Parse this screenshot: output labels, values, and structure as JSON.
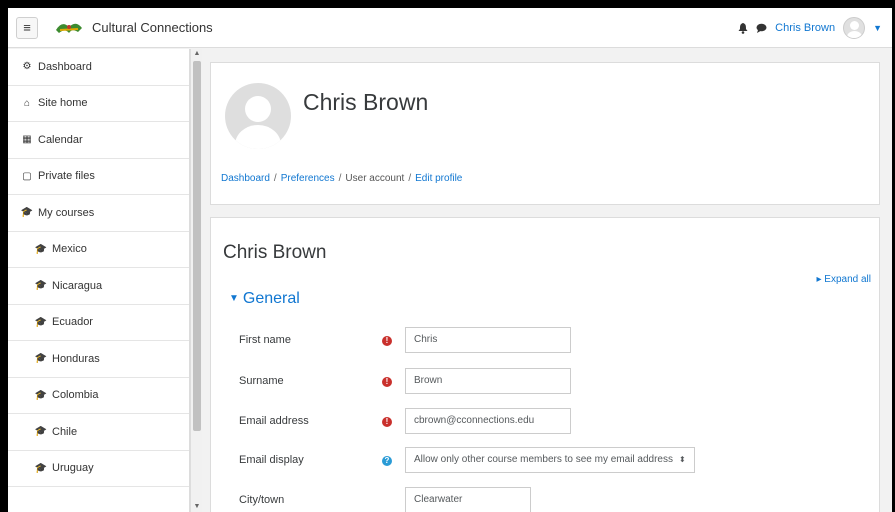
{
  "navbar": {
    "site_name": "Cultural Connections",
    "user_name": "Chris Brown",
    "menu_icon": "≡",
    "bell_icon": "🔔",
    "chat_icon": "●",
    "caret": "▼"
  },
  "sidebar": {
    "items": [
      {
        "label": "Dashboard",
        "icon": "dashboard-icon",
        "glyph": "⚙"
      },
      {
        "label": "Site home",
        "icon": "home-icon",
        "glyph": "⌂"
      },
      {
        "label": "Calendar",
        "icon": "calendar-icon",
        "glyph": "▦"
      },
      {
        "label": "Private files",
        "icon": "file-icon",
        "glyph": "▢"
      },
      {
        "label": "My courses",
        "icon": "graduation-cap-icon",
        "glyph": "🎓"
      },
      {
        "label": "Mexico",
        "icon": "graduation-cap-icon",
        "glyph": "🎓"
      },
      {
        "label": "Nicaragua",
        "icon": "graduation-cap-icon",
        "glyph": "🎓"
      },
      {
        "label": "Ecuador",
        "icon": "graduation-cap-icon",
        "glyph": "🎓"
      },
      {
        "label": "Honduras",
        "icon": "graduation-cap-icon",
        "glyph": "🎓"
      },
      {
        "label": "Colombia",
        "icon": "graduation-cap-icon",
        "glyph": "🎓"
      },
      {
        "label": "Chile",
        "icon": "graduation-cap-icon",
        "glyph": "🎓"
      },
      {
        "label": "Uruguay",
        "icon": "graduation-cap-icon",
        "glyph": "🎓"
      }
    ]
  },
  "header": {
    "name": "Chris Brown",
    "breadcrumb": {
      "dashboard": "Dashboard",
      "preferences": "Preferences",
      "user_account": "User account",
      "edit_profile": "Edit profile",
      "sep": "/"
    }
  },
  "form": {
    "title": "Chris Brown",
    "expand_all": "Expand all",
    "section": "General",
    "fields": {
      "first_name": {
        "label": "First name",
        "value": "Chris"
      },
      "surname": {
        "label": "Surname",
        "value": "Brown"
      },
      "email": {
        "label": "Email address",
        "value": "cbrown@cconnections.edu"
      },
      "email_display": {
        "label": "Email display",
        "value": "Allow only other course members to see my email address"
      },
      "city": {
        "label": "City/town",
        "value": "Clearwater"
      }
    },
    "required_glyph": "!",
    "help_glyph": "?"
  },
  "colors": {
    "link": "#1177d1",
    "required": "#c9302c",
    "help": "#2a9bd6"
  }
}
